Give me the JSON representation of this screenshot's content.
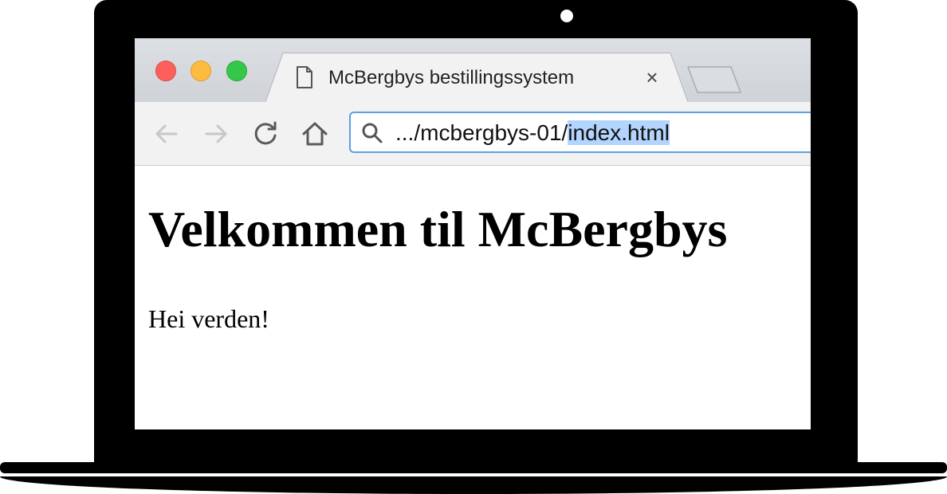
{
  "browser": {
    "tab": {
      "title": "McBergbys bestillingssystem",
      "close_symbol": "×",
      "icon": "document-icon"
    },
    "traffic_lights": {
      "close_color": "#fc605c",
      "minimize_color": "#fdbc40",
      "zoom_color": "#34c84a"
    },
    "toolbar": {
      "back_icon": "arrow-left-icon",
      "forward_icon": "arrow-right-icon",
      "reload_icon": "reload-icon",
      "home_icon": "home-icon"
    },
    "address_bar": {
      "url_prefix": ".../mcbergbys-01/",
      "url_selected": "index.html",
      "focus_color": "#5b9fe6",
      "selection_color": "#b3d4fd"
    }
  },
  "page": {
    "heading": "Velkommen til McBergbys",
    "paragraph": "Hei verden!"
  }
}
